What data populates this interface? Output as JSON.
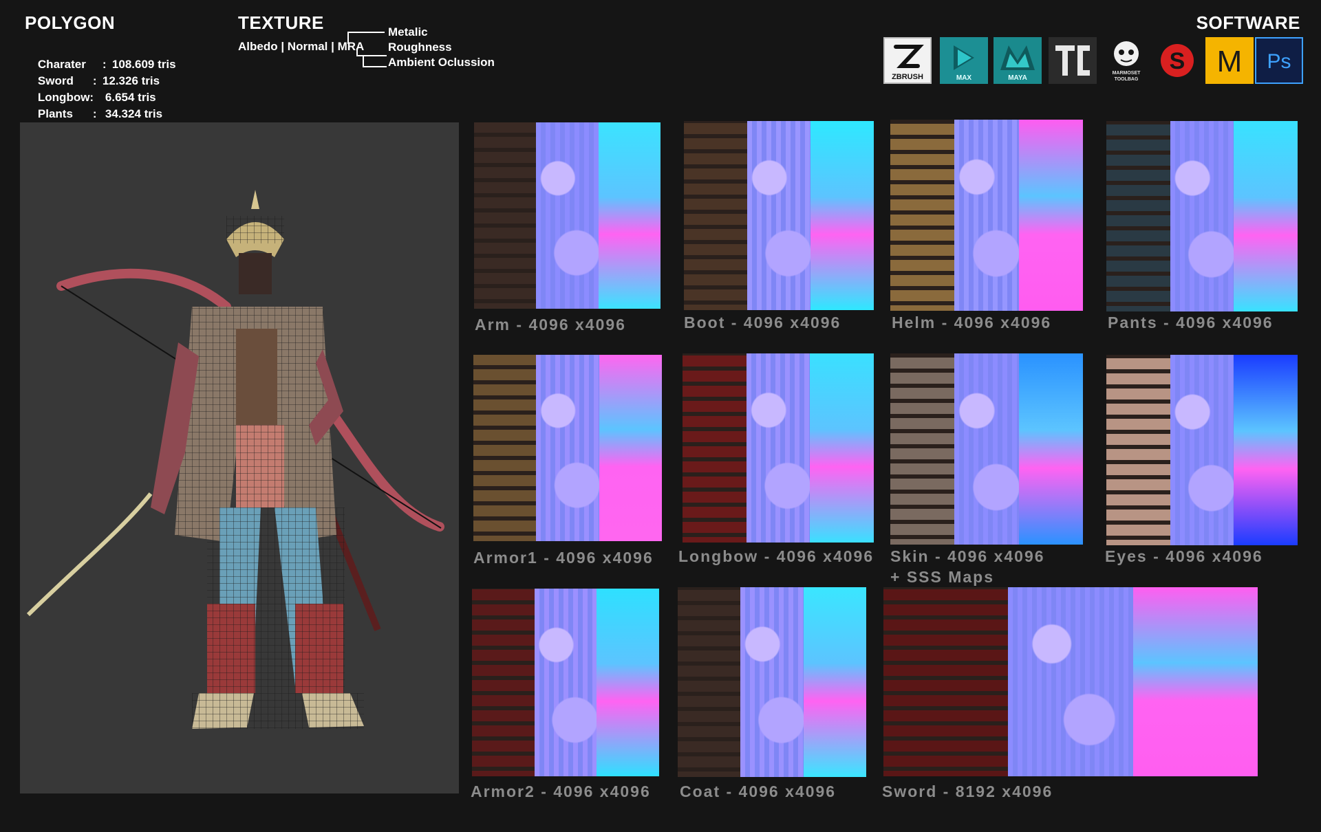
{
  "polygon": {
    "title": "POLYGON",
    "rows": [
      {
        "name": "Charater",
        "sep": ":",
        "value": "108.609 tris"
      },
      {
        "name": "Sword",
        "sep": ":",
        "value": "12.326 tris"
      },
      {
        "name": "Longbow:",
        "sep": "",
        "value": "6.654 tris"
      },
      {
        "name": "Plants",
        "sep": ":",
        "value": "34.324 tris"
      }
    ]
  },
  "texture": {
    "title": "TEXTURE",
    "maps_line": "Albedo | Normal | MRA",
    "mra_parts": [
      "Metalic",
      "Roughness",
      "Ambient Oclussion"
    ]
  },
  "software": {
    "title": "SOFTWARE",
    "icons": [
      {
        "name": "zbrush-icon",
        "label": "ZBRUSH"
      },
      {
        "name": "3dsmax-icon",
        "label": "MAX"
      },
      {
        "name": "maya-icon",
        "label": "MAYA"
      },
      {
        "name": "texturing-tool-icon",
        "label": "TG"
      },
      {
        "name": "marmoset-toolbag-icon",
        "label": "MARMOSET TOOLBAG"
      },
      {
        "name": "substance-painter-icon",
        "label": "S"
      },
      {
        "name": "marvelous-designer-icon",
        "label": "M"
      },
      {
        "name": "photoshop-icon",
        "label": "Ps"
      }
    ]
  },
  "textures": [
    {
      "label": "Arm - 4096 x4096"
    },
    {
      "label": "Boot - 4096 x4096"
    },
    {
      "label": "Helm - 4096 x4096"
    },
    {
      "label": "Pants - 4096 x4096"
    },
    {
      "label": "Armor1 - 4096 x4096"
    },
    {
      "label": "Longbow - 4096 x4096"
    },
    {
      "label": "Skin - 4096 x4096",
      "extra": "+ SSS Maps"
    },
    {
      "label": "Eyes - 4096 x4096"
    },
    {
      "label": "Armor2 - 4096 x4096"
    },
    {
      "label": "Coat - 4096 x4096"
    },
    {
      "label": "Sword - 8192 x4096"
    }
  ],
  "colors": {
    "background": "#151515",
    "viewport": "#383838",
    "label_grey": "#8c8c8c",
    "normal_map": "#8b8bff",
    "mra_cyan": "#2ae1ff",
    "mra_magenta": "#ff63f2"
  }
}
